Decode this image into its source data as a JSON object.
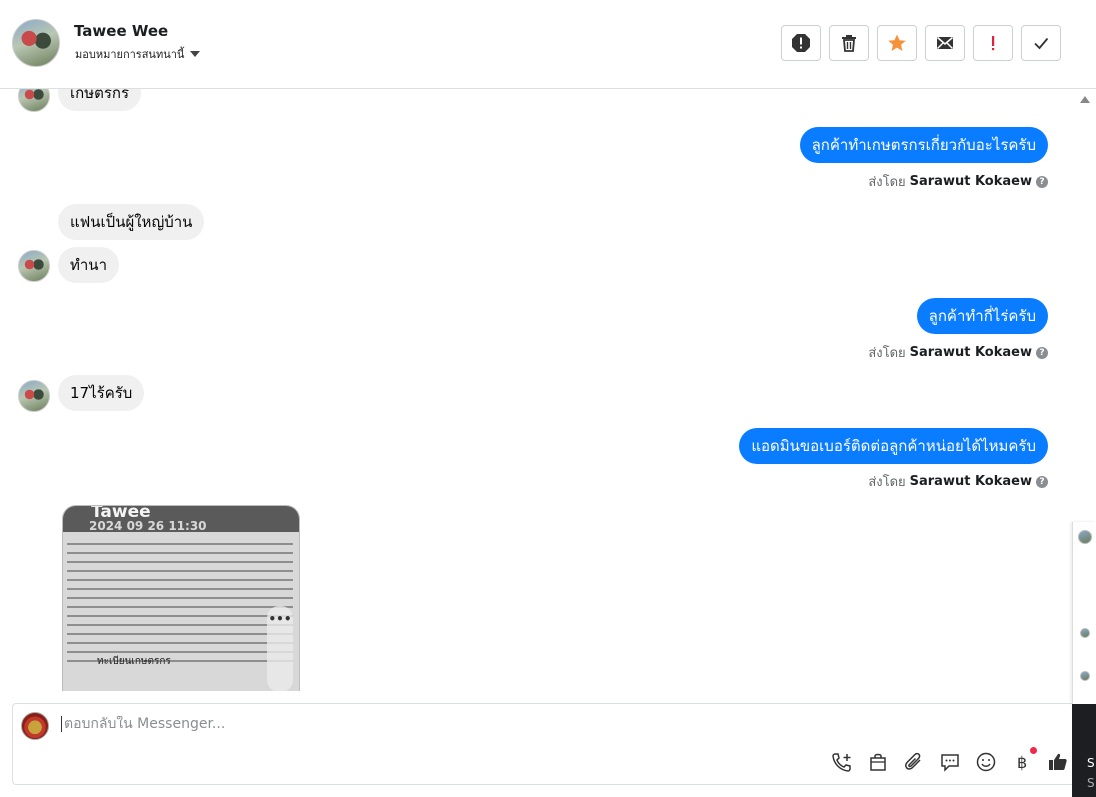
{
  "header": {
    "contact_name": "Tawee Wee",
    "assign_label": "มอบหมายการสนทนานี้"
  },
  "toolbar": {
    "buttons": [
      "spam-icon",
      "trash-icon",
      "star-icon",
      "mail-icon",
      "important-icon",
      "check-icon"
    ],
    "star_color": "#f7923a",
    "important_color": "#e41e3f"
  },
  "messages": {
    "m1": "เกษตรกร",
    "m2": "ลูกค้าทำเกษตรกรเกี่ยวกับอะไรครับ",
    "m3": "แฟนเป็นผู้ใหญ่บ้าน",
    "m4": "ทำนา",
    "m5": "ลูกค้าทำกี่ไร่ครับ",
    "m6": "17ไร้ครับ",
    "m7": "แอดมินขอเบอร์ติดต่อลูกค้าหน่อยได้ไหมครับ"
  },
  "sent_by": {
    "prefix": "ส่งโดย",
    "name": "Sarawut Kokaew"
  },
  "attachment": {
    "name": "Tawee",
    "time": "2024 09 26 11:30",
    "doc_title": "ทะเบียนเกษตรกร"
  },
  "composer": {
    "placeholder": "ตอบกลับใน Messenger..."
  },
  "accent_color": "#0a7cff"
}
